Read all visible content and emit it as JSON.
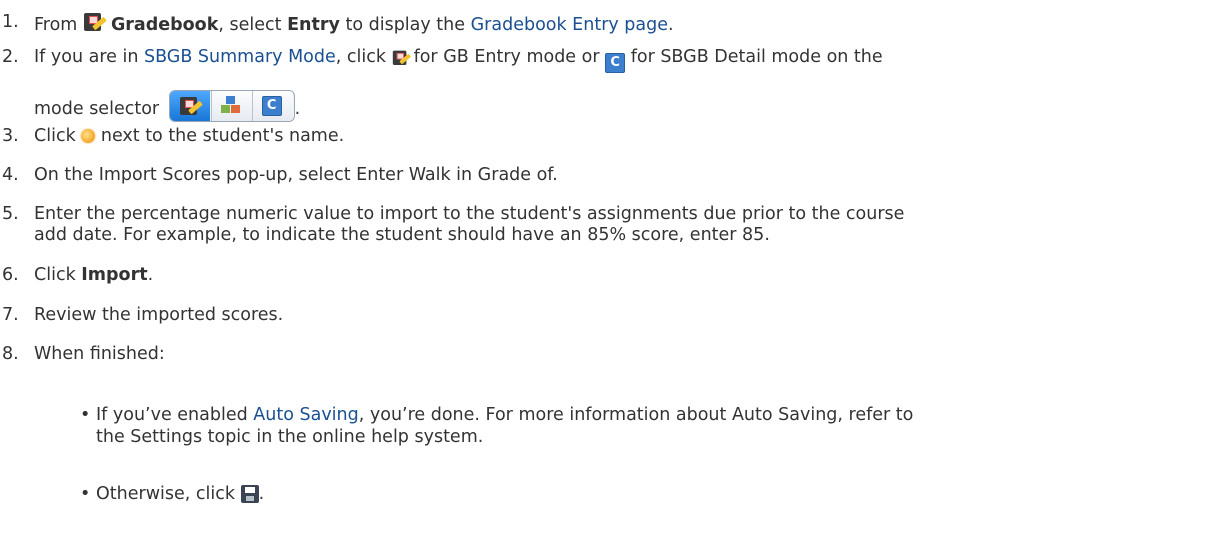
{
  "steps": [
    {
      "num": "1.",
      "a": "From",
      "b": "Gradebook",
      "c": ", select",
      "d": "Entry",
      "e": "to display the",
      "f": "Gradebook Entry page",
      "g": "."
    },
    {
      "num": "2.",
      "a": "If you are in",
      "b": "SBGB Summary Mode",
      "c": ", click",
      "d": "for GB Entry mode or",
      "e": "for SBGB Detail mode on the",
      "line2": "mode selector",
      "g": "."
    },
    {
      "num": "3.",
      "a": "Click",
      "b": "next to the student's name."
    },
    {
      "num": "4.",
      "a": "On the Import Scores pop-up, select Enter Walk in Grade of."
    },
    {
      "num": "5.",
      "a": "Enter the percentage numeric value to import to the student's assignments due prior to the course",
      "line2": "add date. For example, to indicate the student should have an 85% score, enter 85."
    },
    {
      "num": "6.",
      "a": "Click",
      "b": "Import",
      "c": "."
    },
    {
      "num": "7.",
      "a": "Review the imported scores."
    },
    {
      "num": "8.",
      "a": "When finished:"
    }
  ],
  "bullets": [
    {
      "dot": "•",
      "a": "If you’ve enabled",
      "b": "Auto Saving",
      "c": ", you’re done. For more information about Auto Saving, refer to",
      "line2": "the Settings topic in the online help system."
    },
    {
      "dot": "•",
      "a": "Otherwise, click",
      "c": "."
    }
  ],
  "icons": {
    "gradebook": "gradebook-icon",
    "entry_mode": "gb-entry-mode-icon",
    "detail_mode": "sbgb-detail-mode-icon",
    "import": "import-scores-icon",
    "save": "save-icon",
    "selector": "mode-selector",
    "link_color": "#1a4f91"
  },
  "colors": {
    "text": "#333333",
    "link": "#1a4f91"
  }
}
